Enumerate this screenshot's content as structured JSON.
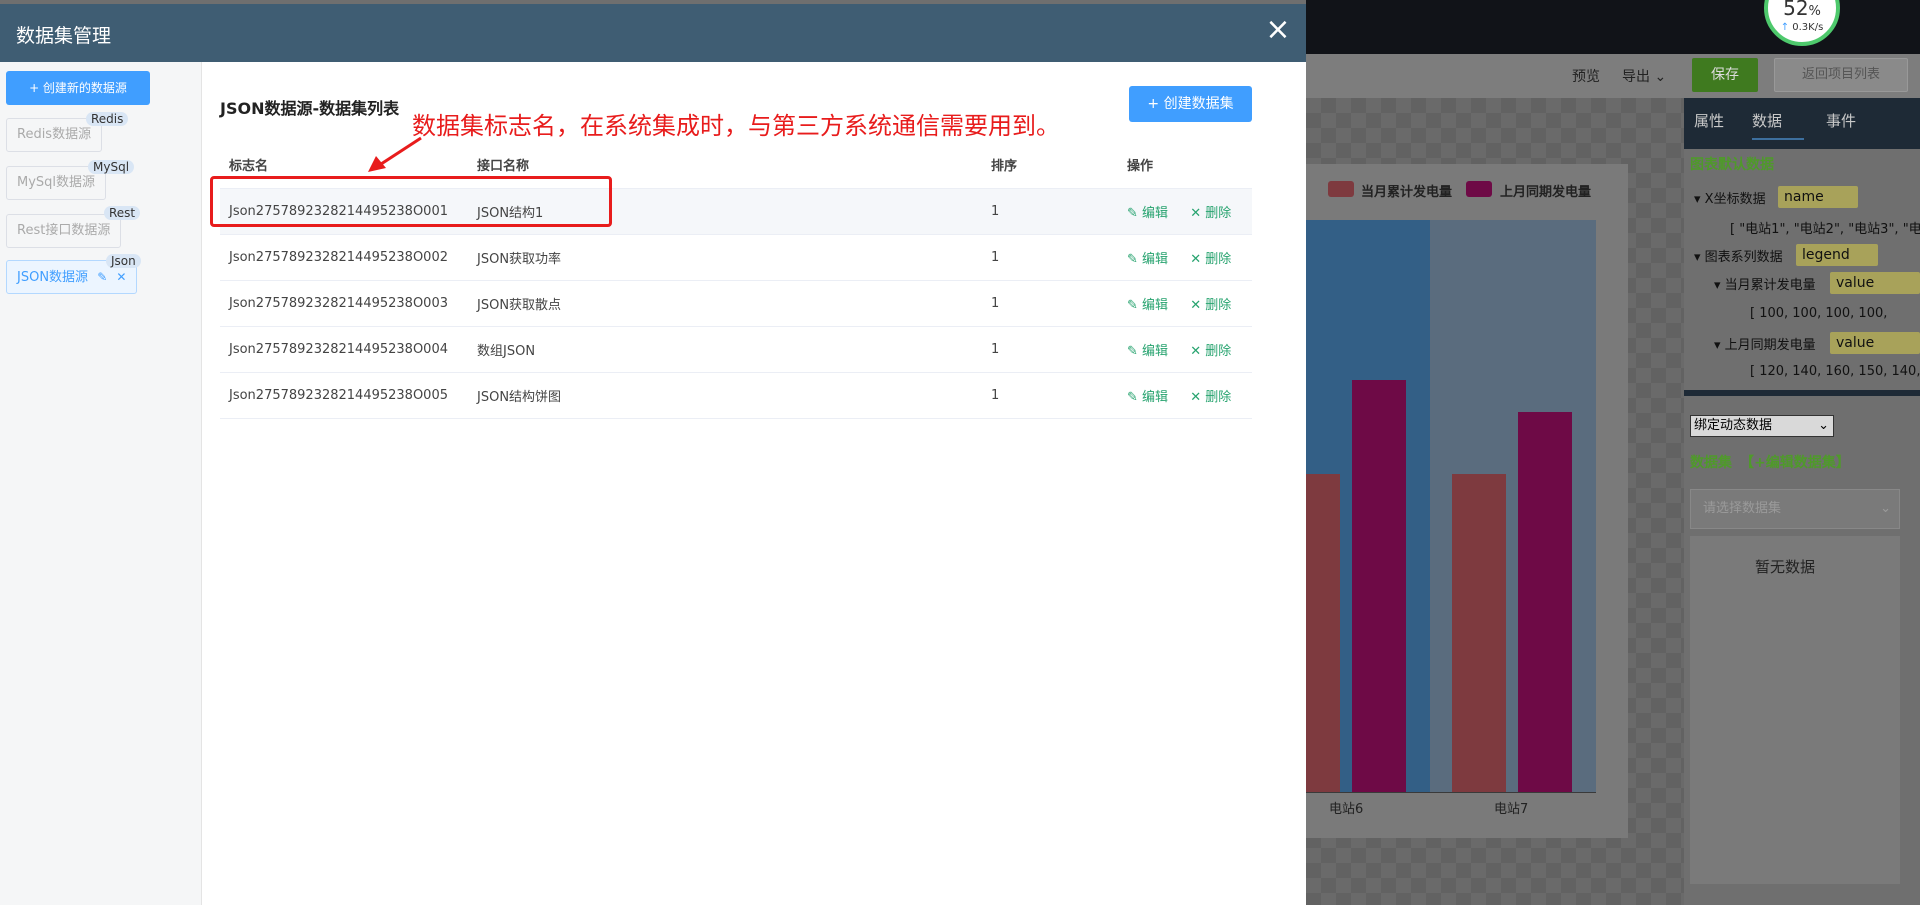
{
  "background_app": {
    "toolbar": {
      "preview": "预览",
      "export": "导出",
      "save": "保存",
      "back": "返回项目列表"
    },
    "gauge": {
      "value": "52",
      "unit": "%",
      "speed": "0.3K/s"
    },
    "chart": {
      "legend": [
        {
          "label": "当月累计发电量",
          "color": "#7e3a3f"
        },
        {
          "label": "上月同期发电量",
          "color": "#6e0a46"
        }
      ],
      "categories": [
        "电站6",
        "电站7"
      ]
    },
    "right_panel": {
      "tabs": [
        "属性",
        "数据",
        "事件"
      ],
      "section_title": "图表默认数据",
      "x_data_label": "X坐标数据",
      "x_data_field": "name",
      "x_data_value": "[ \"电站1\", \"电站2\", \"电站3\", \"电",
      "series_label": "图表系列数据",
      "series_field": "legend",
      "series1_label": "当月累计发电量",
      "series1_field": "value",
      "series1_value": "[ 100, 100, 100, 100,",
      "series2_label": "上月同期发电量",
      "series2_field": "value",
      "series2_value": "[ 120, 140, 160, 150, 140,",
      "bind_select": "绑定动态数据",
      "dataset_label": "数据集",
      "edit_dataset": "【+编辑数据集】",
      "dataset_placeholder": "请选择数据集",
      "empty_text": "暂无数据"
    }
  },
  "modal": {
    "title": "数据集管理",
    "sidebar": {
      "new_button": "+ 创建新的数据源",
      "items": [
        {
          "label": "Redis数据源",
          "tag": "Redis"
        },
        {
          "label": "MySql数据源",
          "tag": "MySql"
        },
        {
          "label": "Rest接口数据源",
          "tag": "Rest"
        },
        {
          "label": "JSON数据源",
          "tag": "Json"
        }
      ]
    },
    "content": {
      "title": "JSON数据源-数据集列表",
      "create_button": "+ 创建数据集",
      "annotation": "数据集标志名，在系统集成时，与第三方系统通信需要用到。",
      "columns": [
        "标志名",
        "接口名称",
        "排序",
        "操作"
      ],
      "actions": {
        "edit": "编辑",
        "delete": "删除"
      },
      "rows": [
        {
          "id": "Json2757892328214495238O001",
          "name": "JSON结构1",
          "order": "1"
        },
        {
          "id": "Json2757892328214495238O002",
          "name": "JSON获取功率",
          "order": "1"
        },
        {
          "id": "Json2757892328214495238O003",
          "name": "JSON获取散点",
          "order": "1"
        },
        {
          "id": "Json2757892328214495238O004",
          "name": "数组JSON",
          "order": "1"
        },
        {
          "id": "Json2757892328214495238O005",
          "name": "JSON结构饼图",
          "order": "1"
        }
      ]
    }
  }
}
